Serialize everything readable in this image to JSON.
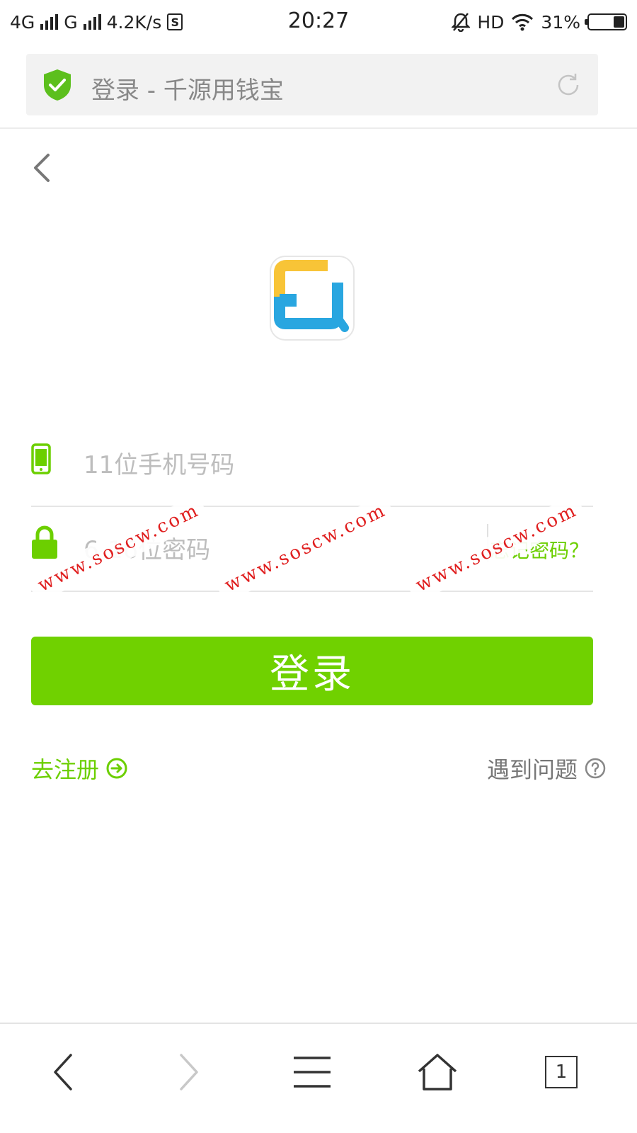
{
  "status_bar": {
    "network1": "4G",
    "network2": "G",
    "speed": "4.2K/s",
    "sim_badge": "S",
    "time": "20:27",
    "hd": "HD",
    "battery_percent": "31%",
    "battery_level": 0.31
  },
  "address_bar": {
    "title": "登录 - 千源用钱宝",
    "secure_color": "#5cbf1d"
  },
  "login_form": {
    "phone_placeholder": "11位手机号码",
    "password_placeholder": "6-16位密码",
    "forgot_link": "忘记密码？",
    "submit_label": "登录"
  },
  "footer_links": {
    "register": "去注册",
    "help": "遇到问题"
  },
  "watermark": {
    "text": "www.soscw.com"
  },
  "bottom_nav": {
    "tabs_count": "1"
  },
  "colors": {
    "accent": "#70d100",
    "watermark": "#e02020"
  }
}
